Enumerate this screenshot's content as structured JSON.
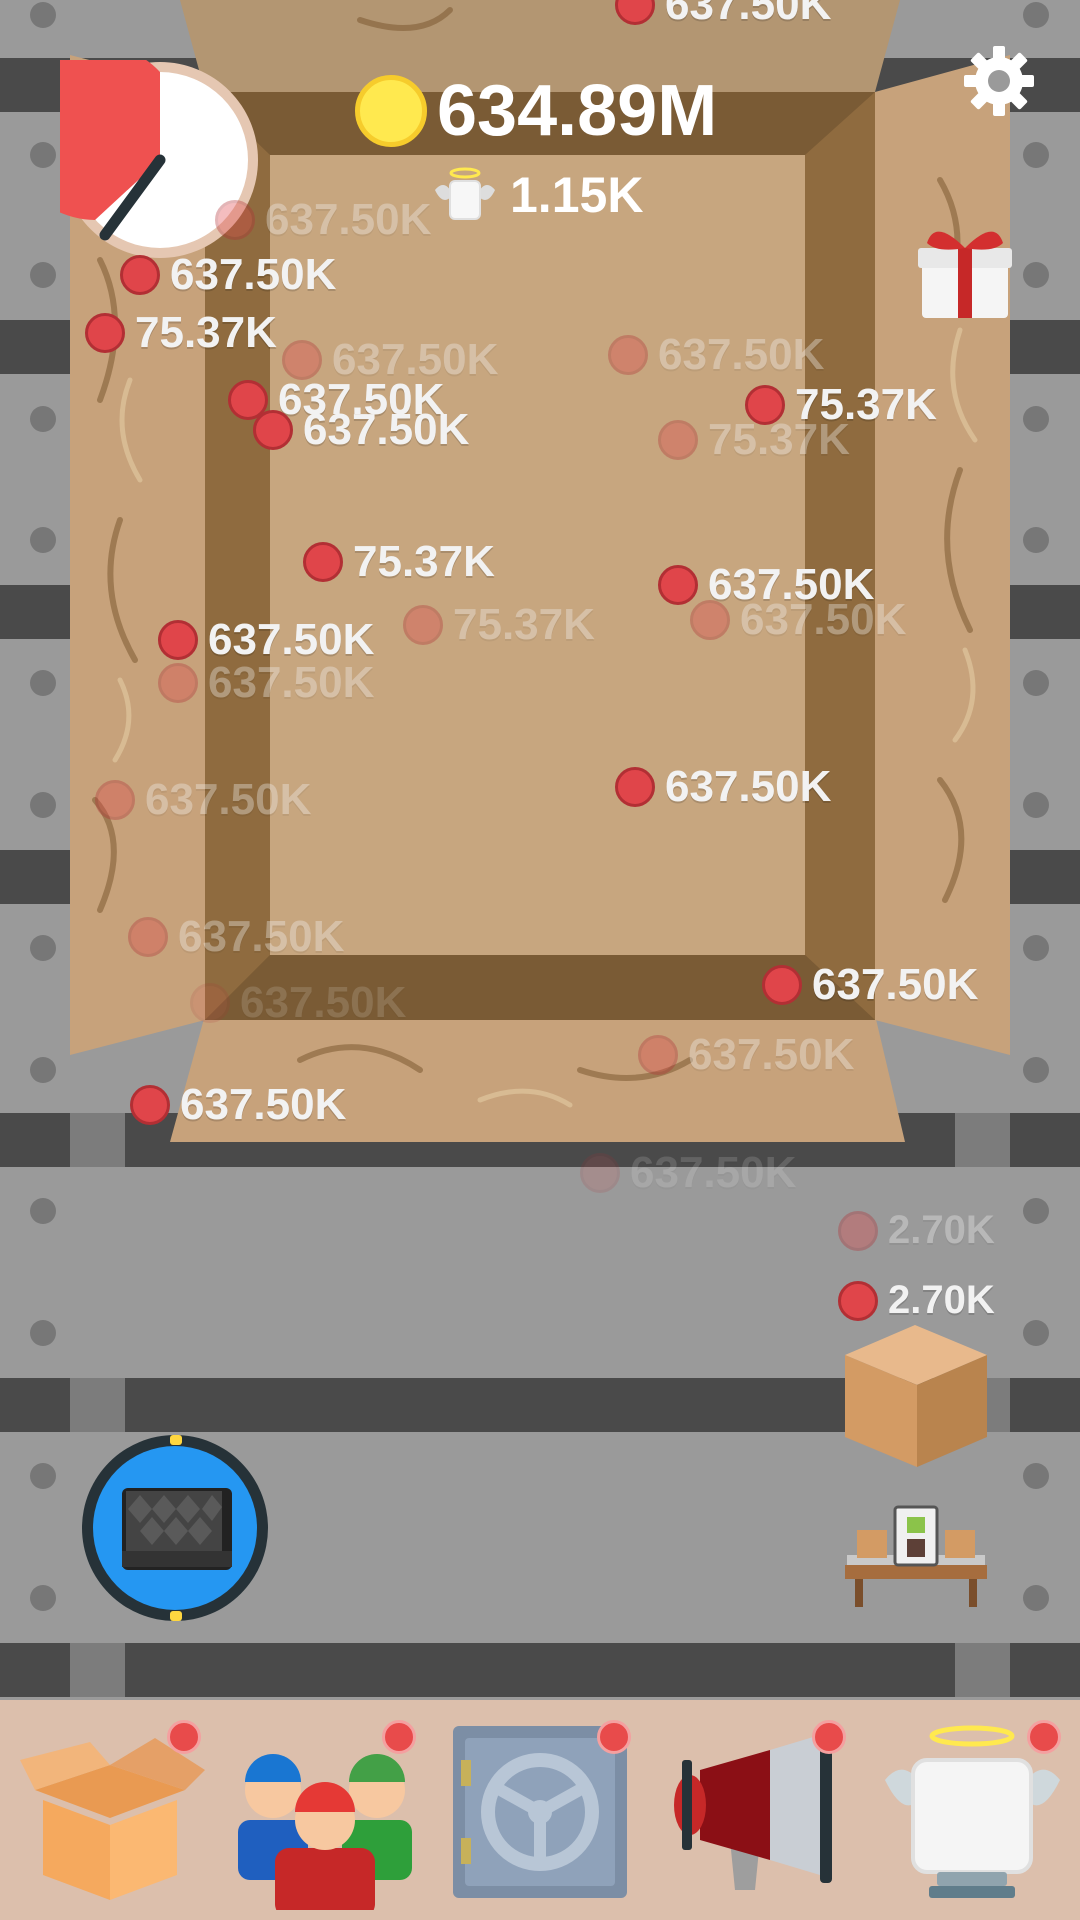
{
  "header": {
    "coin_total": "634.89M",
    "angel_count": "1.15K"
  },
  "icons": {
    "timer": "stopwatch-icon",
    "coin": "coin-icon",
    "angel": "angel-box-icon",
    "settings": "gear-icon",
    "gift": "gift-icon"
  },
  "popups": [
    {
      "text": "637.50K"
    },
    {
      "text": "637.50K"
    },
    {
      "text": "637.50K"
    },
    {
      "text": "75.37K"
    },
    {
      "text": "637.50K"
    },
    {
      "text": "637.50K"
    },
    {
      "text": "637.50K"
    },
    {
      "text": "637.50K"
    },
    {
      "text": "75.37K"
    },
    {
      "text": "75.37K"
    },
    {
      "text": "75.37K"
    },
    {
      "text": "637.50K"
    },
    {
      "text": "637.50K"
    },
    {
      "text": "75.37K"
    },
    {
      "text": "637.50K"
    },
    {
      "text": "637.50K"
    },
    {
      "text": "637.50K"
    },
    {
      "text": "637.50K"
    },
    {
      "text": "637.50K"
    },
    {
      "text": "637.50K"
    },
    {
      "text": "637.50K"
    },
    {
      "text": "637.50K"
    },
    {
      "text": "2.70K"
    },
    {
      "text": "2.70K"
    },
    {
      "text": "637.50K"
    },
    {
      "text": "637.50K"
    }
  ],
  "bottom_nav": [
    {
      "name": "boxes",
      "icon": "open-box-icon",
      "has_badge": true
    },
    {
      "name": "workers",
      "icon": "workers-icon",
      "has_badge": true
    },
    {
      "name": "vault",
      "icon": "safe-icon",
      "has_badge": true
    },
    {
      "name": "marketing",
      "icon": "megaphone-icon",
      "has_badge": true
    },
    {
      "name": "angels",
      "icon": "angel-box-icon",
      "has_badge": true
    }
  ],
  "colors": {
    "box_light": "#c9a57f",
    "box_dark": "#7d5f37",
    "belt": "#4a4a4a",
    "accent_red": "#e0454a",
    "boost_blue": "#2597f2"
  }
}
